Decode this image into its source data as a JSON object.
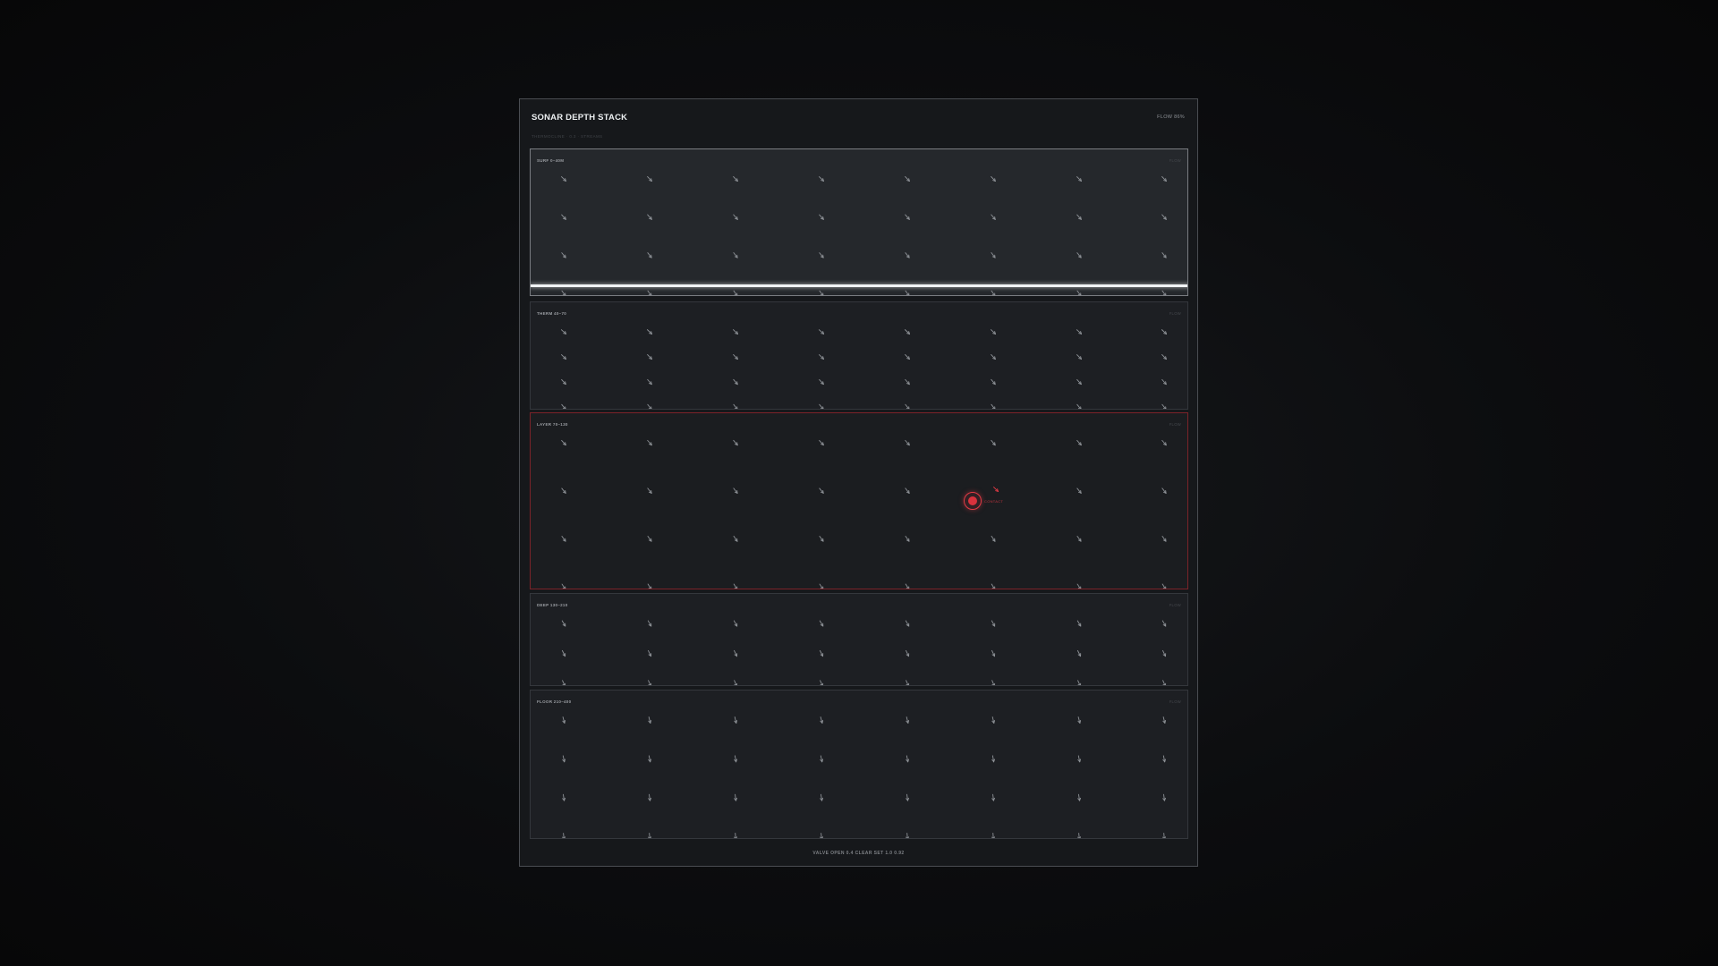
{
  "panel": {
    "title": "SONAR DEPTH STACK",
    "flow": "FLOW 86%",
    "subcaption": "THERMOCLINE  ·  0.3  ·  STREAMS"
  },
  "layers": [
    {
      "name": "SURF 0–40M",
      "tag": "FLOW",
      "state": "active",
      "rows": 4,
      "angle": 45
    },
    {
      "name": "THERM 40–70",
      "tag": "FLOW",
      "state": "normal",
      "rows": 4,
      "angle": 42
    },
    {
      "name": "LAYER 70–130",
      "tag": "FLOW",
      "state": "alert",
      "rows": 4,
      "angle": 48
    },
    {
      "name": "DEEP 130–210",
      "tag": "FLOW",
      "state": "normal",
      "rows": 3,
      "angle": 60
    },
    {
      "name": "FLOOR 210–400",
      "tag": "FLOW",
      "state": "normal",
      "rows": 4,
      "angle": 75
    }
  ],
  "contact": {
    "label": "CONTACT"
  },
  "footer": {
    "text": "VALVE OPEN  0.4  CLEAR  SET 1.0 0.92"
  },
  "colors": {
    "alert": "#e23a45",
    "arrow": "#8f9398",
    "accent": "#f2f4f6"
  }
}
